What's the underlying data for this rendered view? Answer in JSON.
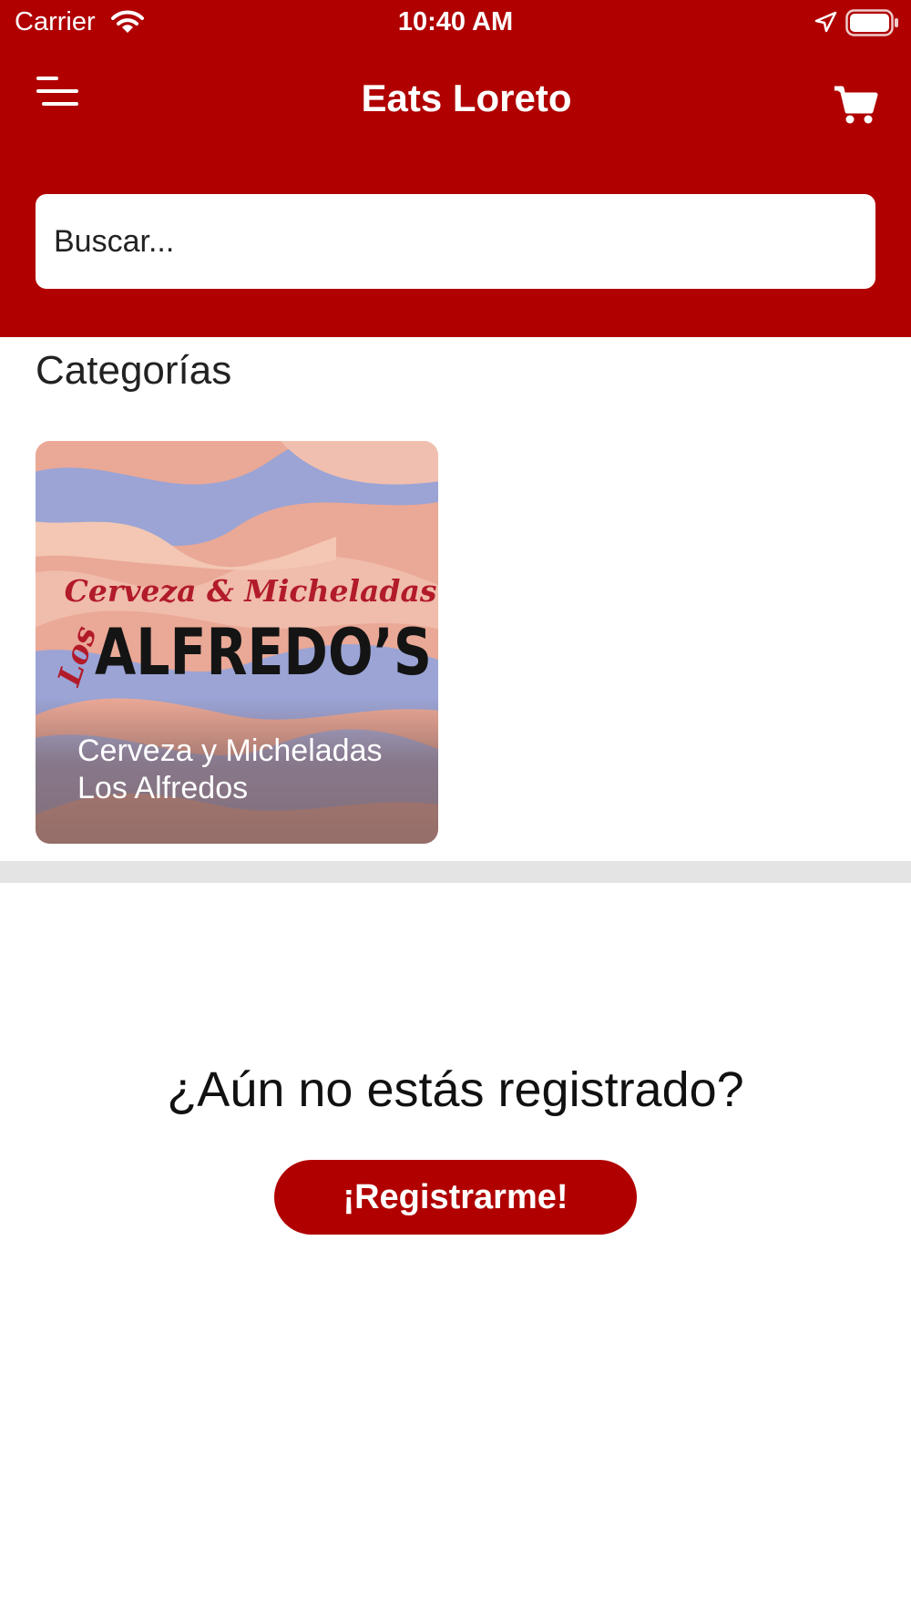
{
  "status_bar": {
    "carrier": "Carrier",
    "time": "10:40 AM"
  },
  "header": {
    "title": "Eats Loreto",
    "menu_icon": "hamburger-menu-icon",
    "cart_icon": "shopping-cart-icon"
  },
  "search": {
    "placeholder": "Buscar..."
  },
  "categories": {
    "title": "Categorías",
    "items": [
      {
        "label": "Cerveza y Micheladas Los Alfredos",
        "logo_tagline": "Cerveza & Micheladas",
        "logo_prefix": "Los",
        "logo_name": "ALFREDO’S"
      }
    ]
  },
  "register": {
    "question": "¿Aún no estás registrado?",
    "button_label": "¡Registrarme!"
  },
  "colors": {
    "brand_red": "#b00000",
    "divider": "#e4e4e4",
    "card_peach": "#e8a896",
    "card_blue": "#8ea4e0"
  }
}
